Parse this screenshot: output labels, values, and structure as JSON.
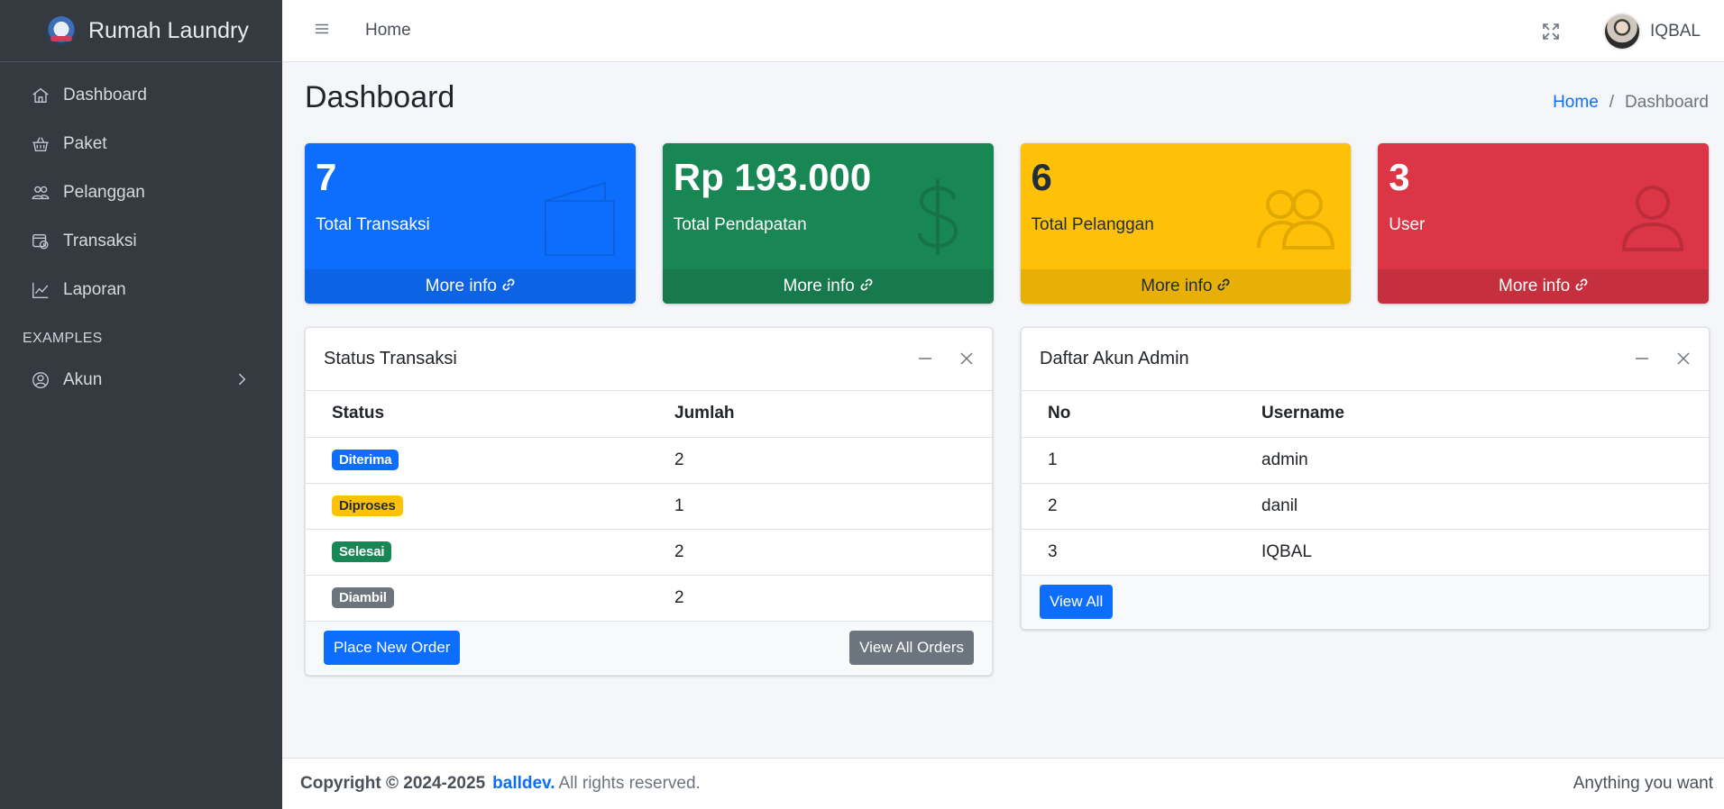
{
  "brand": {
    "name": "Rumah Laundry"
  },
  "sidebar": {
    "items": [
      {
        "label": "Dashboard",
        "icon": "house-icon"
      },
      {
        "label": "Paket",
        "icon": "basket-icon"
      },
      {
        "label": "Pelanggan",
        "icon": "people-icon"
      },
      {
        "label": "Transaksi",
        "icon": "transaction-icon"
      },
      {
        "label": "Laporan",
        "icon": "graph-icon"
      }
    ],
    "header": "EXAMPLES",
    "akun": {
      "label": "Akun",
      "icon": "person-circle-icon"
    }
  },
  "topbar": {
    "home": "Home",
    "user": "IQBAL"
  },
  "page": {
    "title": "Dashboard",
    "breadcrumb": {
      "home": "Home",
      "sep": "/",
      "current": "Dashboard"
    }
  },
  "boxes": [
    {
      "value": "7",
      "label": "Total Transaksi",
      "more": "More info",
      "color": "#0d6efd",
      "icon": "wallet-icon"
    },
    {
      "value": "Rp 193.000",
      "label": "Total Pendapatan",
      "more": "More info",
      "color": "#198754",
      "icon": "dollar-icon"
    },
    {
      "value": "6",
      "label": "Total Pelanggan",
      "more": "More info",
      "color": "#ffc107",
      "icon": "people-icon"
    },
    {
      "value": "3",
      "label": "User",
      "more": "More info",
      "color": "#dc3545",
      "icon": "person-icon"
    }
  ],
  "status_card": {
    "title": "Status Transaksi",
    "columns": [
      "Status",
      "Jumlah"
    ],
    "rows": [
      {
        "status": "Diterima",
        "jumlah": "2",
        "color": "#0d6efd"
      },
      {
        "status": "Diproses",
        "jumlah": "1",
        "color": "#ffc107"
      },
      {
        "status": "Selesai",
        "jumlah": "2",
        "color": "#198754"
      },
      {
        "status": "Diambil",
        "jumlah": "2",
        "color": "#6c757d"
      }
    ],
    "btn_new": "Place New Order",
    "btn_all": "View All Orders"
  },
  "admin_card": {
    "title": "Daftar Akun Admin",
    "columns": [
      "No",
      "Username"
    ],
    "rows": [
      {
        "no": "1",
        "username": "admin"
      },
      {
        "no": "2",
        "username": "danil"
      },
      {
        "no": "3",
        "username": "IQBAL"
      }
    ],
    "btn_all": "View All"
  },
  "footer": {
    "copyright": "Copyright © 2024-2025",
    "link": "balldev.",
    "rights": "All rights reserved.",
    "right": "Anything you want"
  }
}
